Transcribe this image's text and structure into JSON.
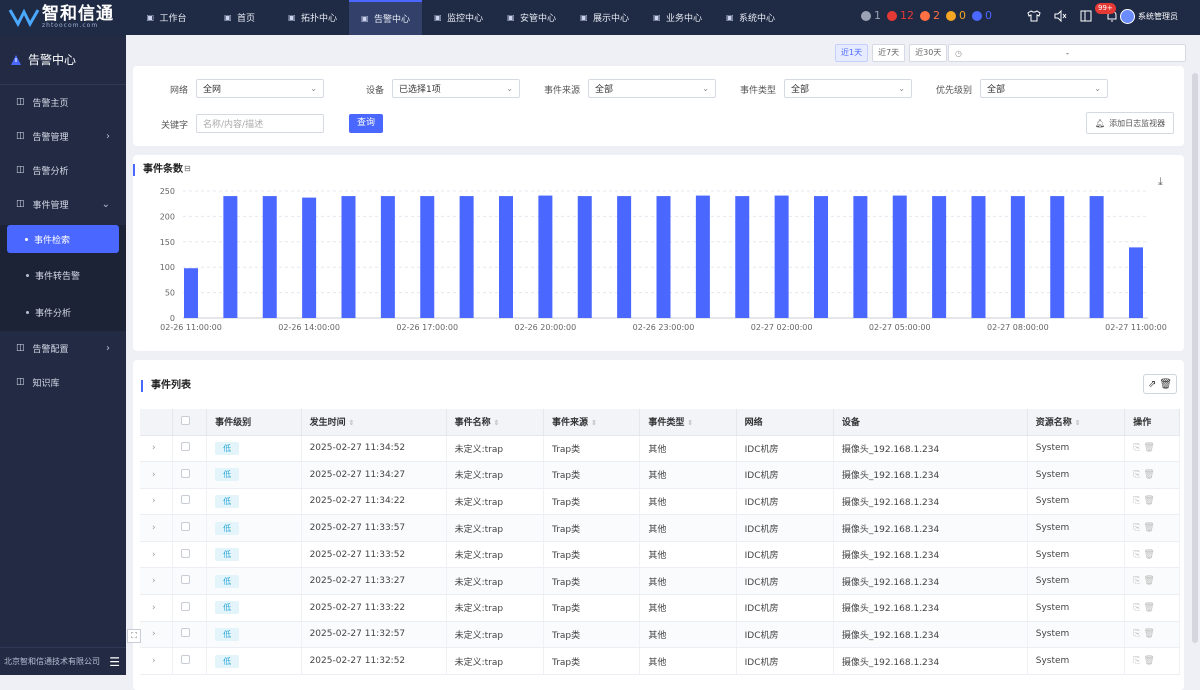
{
  "header": {
    "logo_text": "智和信通",
    "logo_sub": "zhtoocom.com",
    "nav": [
      {
        "label": "工作台",
        "icon": "home-icon"
      },
      {
        "label": "首页",
        "icon": "home-icon"
      },
      {
        "label": "拓扑中心",
        "icon": "topology-icon"
      },
      {
        "label": "告警中心",
        "icon": "warning-icon",
        "active": true
      },
      {
        "label": "监控中心",
        "icon": "monitor-icon"
      },
      {
        "label": "安管中心",
        "icon": "shield-icon"
      },
      {
        "label": "展示中心",
        "icon": "display-icon"
      },
      {
        "label": "业务中心",
        "icon": "business-icon"
      },
      {
        "label": "系统中心",
        "icon": "system-icon"
      }
    ],
    "stats": [
      {
        "value": "1",
        "color": "#9aa2b3"
      },
      {
        "value": "12",
        "color": "#e53935"
      },
      {
        "value": "2",
        "color": "#ff7043"
      },
      {
        "value": "0",
        "color": "#f5a623"
      },
      {
        "value": "0",
        "color": "#4a67ff"
      }
    ],
    "notification_badge": "99+",
    "user_name": "系统管理员"
  },
  "sidebar": {
    "title": "告警中心",
    "items": [
      {
        "label": "告警主页",
        "icon": "home-icon"
      },
      {
        "label": "告警管理",
        "icon": "bell-icon",
        "arrow": "›"
      },
      {
        "label": "告警分析",
        "icon": "analysis-icon"
      },
      {
        "label": "事件管理",
        "icon": "document-icon",
        "arrow": "⌄"
      }
    ],
    "sub_items": [
      {
        "label": "事件检索",
        "active": true
      },
      {
        "label": "事件转告警"
      },
      {
        "label": "事件分析"
      }
    ],
    "items_after": [
      {
        "label": "告警配置",
        "icon": "config-icon",
        "arrow": "›"
      },
      {
        "label": "知识库",
        "icon": "book-icon"
      }
    ],
    "footer": "北京智和信通技术有限公司"
  },
  "date_range": {
    "buttons": [
      "近1天",
      "近7天",
      "近30天"
    ],
    "active": 0,
    "separator": "-"
  },
  "filters": {
    "network_label": "网络",
    "network_value": "全网",
    "device_label": "设备",
    "device_value": "已选择1项",
    "source_label": "事件来源",
    "source_value": "全部",
    "type_label": "事件类型",
    "type_value": "全部",
    "priority_label": "优先级别",
    "priority_value": "全部",
    "keyword_label": "关键字",
    "keyword_placeholder": "名称/内容/描述",
    "query_button": "查询",
    "add_monitor_button": "添加日志监视器"
  },
  "chart_section": {
    "title": "事件条数"
  },
  "chart_data": {
    "type": "bar",
    "title": "事件条数",
    "xlabel": "",
    "ylabel": "",
    "ylim": [
      0,
      250
    ],
    "yticks": [
      0,
      50,
      100,
      150,
      200,
      250
    ],
    "x_tick_labels": [
      "02-26 11:00:00",
      "02-26 14:00:00",
      "02-26 17:00:00",
      "02-26 20:00:00",
      "02-26 23:00:00",
      "02-27 02:00:00",
      "02-27 05:00:00",
      "02-27 08:00:00",
      "02-27 11:00:00"
    ],
    "categories": [
      "02-26 11:00",
      "02-26 12:00",
      "02-26 13:00",
      "02-26 14:00",
      "02-26 15:00",
      "02-26 16:00",
      "02-26 17:00",
      "02-26 18:00",
      "02-26 19:00",
      "02-26 20:00",
      "02-26 21:00",
      "02-26 22:00",
      "02-26 23:00",
      "02-27 00:00",
      "02-27 01:00",
      "02-27 02:00",
      "02-27 03:00",
      "02-27 04:00",
      "02-27 05:00",
      "02-27 06:00",
      "02-27 07:00",
      "02-27 08:00",
      "02-27 09:00",
      "02-27 10:00",
      "02-27 11:00"
    ],
    "values": [
      98,
      240,
      240,
      237,
      240,
      240,
      240,
      240,
      240,
      241,
      240,
      240,
      240,
      241,
      240,
      241,
      240,
      240,
      241,
      240,
      240,
      240,
      240,
      240,
      139
    ],
    "grid": true,
    "color": "#4a67ff"
  },
  "event_list": {
    "title": "事件列表",
    "columns": [
      "事件级别",
      "发生时间",
      "事件名称",
      "事件来源",
      "事件类型",
      "网络",
      "设备",
      "资源名称",
      "操作"
    ],
    "rows": [
      {
        "level": "低",
        "time": "2025-02-27 11:34:52",
        "name": "未定义:trap",
        "source": "Trap类",
        "type": "其他",
        "network": "IDC机房",
        "device": "摄像头_192.168.1.234",
        "resource": "System"
      },
      {
        "level": "低",
        "time": "2025-02-27 11:34:27",
        "name": "未定义:trap",
        "source": "Trap类",
        "type": "其他",
        "network": "IDC机房",
        "device": "摄像头_192.168.1.234",
        "resource": "System"
      },
      {
        "level": "低",
        "time": "2025-02-27 11:34:22",
        "name": "未定义:trap",
        "source": "Trap类",
        "type": "其他",
        "network": "IDC机房",
        "device": "摄像头_192.168.1.234",
        "resource": "System"
      },
      {
        "level": "低",
        "time": "2025-02-27 11:33:57",
        "name": "未定义:trap",
        "source": "Trap类",
        "type": "其他",
        "network": "IDC机房",
        "device": "摄像头_192.168.1.234",
        "resource": "System"
      },
      {
        "level": "低",
        "time": "2025-02-27 11:33:52",
        "name": "未定义:trap",
        "source": "Trap类",
        "type": "其他",
        "network": "IDC机房",
        "device": "摄像头_192.168.1.234",
        "resource": "System"
      },
      {
        "level": "低",
        "time": "2025-02-27 11:33:27",
        "name": "未定义:trap",
        "source": "Trap类",
        "type": "其他",
        "network": "IDC机房",
        "device": "摄像头_192.168.1.234",
        "resource": "System"
      },
      {
        "level": "低",
        "time": "2025-02-27 11:33:22",
        "name": "未定义:trap",
        "source": "Trap类",
        "type": "其他",
        "network": "IDC机房",
        "device": "摄像头_192.168.1.234",
        "resource": "System"
      },
      {
        "level": "低",
        "time": "2025-02-27 11:32:57",
        "name": "未定义:trap",
        "source": "Trap类",
        "type": "其他",
        "network": "IDC机房",
        "device": "摄像头_192.168.1.234",
        "resource": "System"
      },
      {
        "level": "低",
        "time": "2025-02-27 11:32:52",
        "name": "未定义:trap",
        "source": "Trap类",
        "type": "其他",
        "network": "IDC机房",
        "device": "摄像头_192.168.1.234",
        "resource": "System"
      }
    ]
  }
}
